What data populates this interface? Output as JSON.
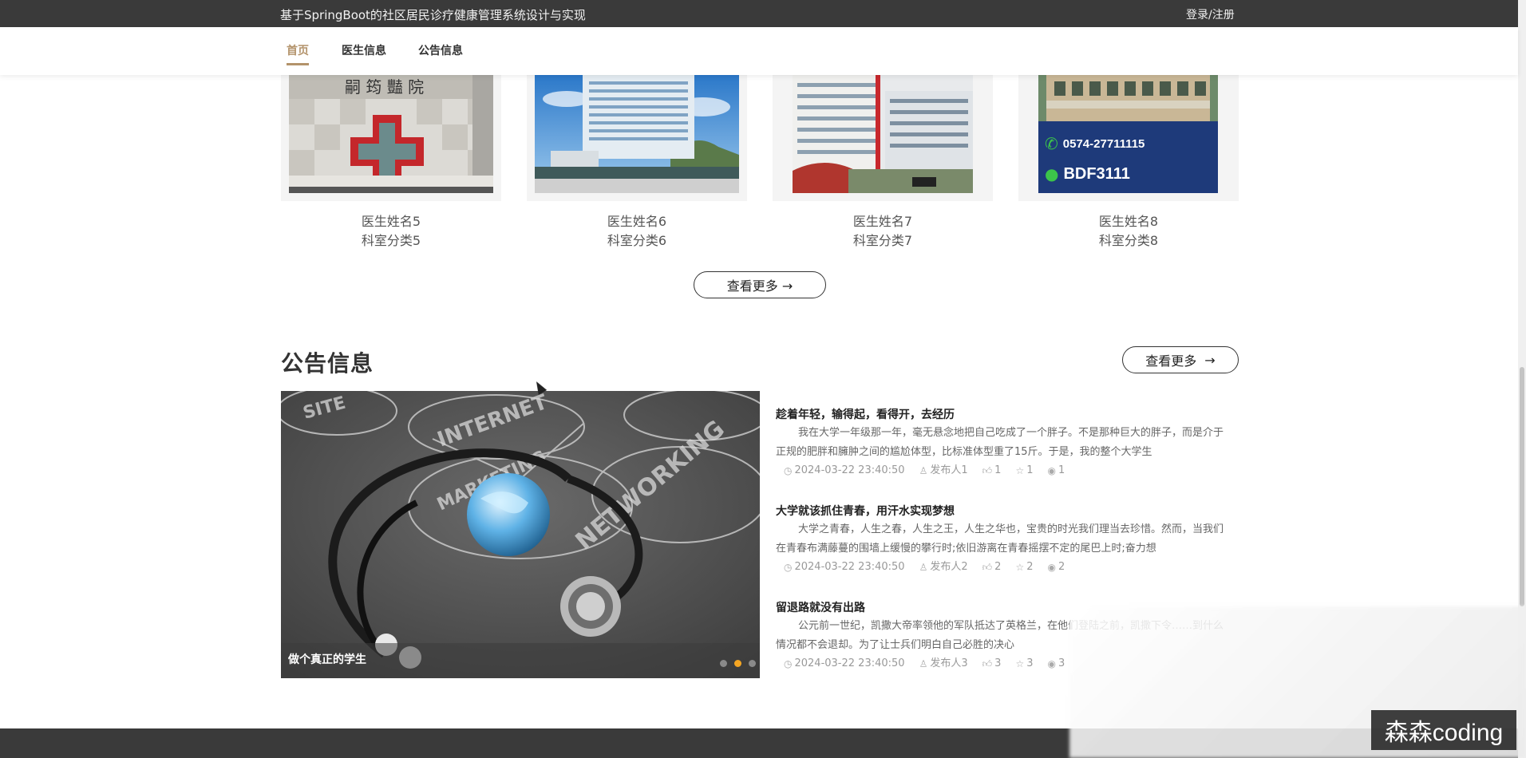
{
  "header": {
    "site_title": "基于SpringBoot的社区居民诊疗健康管理系统设计与实现",
    "login_label": "登录/注册"
  },
  "nav": {
    "items": [
      {
        "label": "首页",
        "active": true
      },
      {
        "label": "医生信息",
        "active": false
      },
      {
        "label": "公告信息",
        "active": false
      }
    ]
  },
  "doctors": [
    {
      "name": "医生姓名5",
      "department": "科室分类5"
    },
    {
      "name": "医生姓名6",
      "department": "科室分类6"
    },
    {
      "name": "医生姓名7",
      "department": "科室分类7"
    },
    {
      "name": "医生姓名8",
      "department": "科室分类8"
    }
  ],
  "doctor_ad": {
    "phone": "0574-27711115",
    "wechat": "BDF3111"
  },
  "doctor_section": {
    "more_label": "查看更多 →"
  },
  "notice_section": {
    "title": "公告信息",
    "more_label": "查看更多",
    "more_arrow": "→"
  },
  "carousel": {
    "caption": "做个真正的学生",
    "dot_count": 3,
    "active_dot": 1,
    "chalk_words": [
      "SITE",
      "INTERNET",
      "NETWORKING",
      "MARKETING"
    ]
  },
  "news": [
    {
      "title": "趁着年轻，输得起，看得开，去经历",
      "summary": "我在大学一年级那一年，毫无悬念地把自己吃成了一个胖子。不是那种巨大的胖子，而是介于正规的肥胖和臃肿之间的尴尬体型，比标准体型重了15斤。于是，我的整个大学生",
      "time": "2024-03-22 23:40:50",
      "publisher": "发布人1",
      "likes": "1",
      "favorites": "1",
      "views": "1"
    },
    {
      "title": "大学就该抓住青春，用汗水实现梦想",
      "summary": "大学之青春，人生之春，人生之王，人生之华也，宝贵的时光我们理当去珍惜。然而，当我们在青春布满藤蔓的围墙上缓慢的攀行时;依旧游离在青春摇摆不定的尾巴上时;奋力想",
      "time": "2024-03-22 23:40:50",
      "publisher": "发布人2",
      "likes": "2",
      "favorites": "2",
      "views": "2"
    },
    {
      "title": "留退路就没有出路",
      "summary": "公元前一世纪，凯撒大帝率领他的军队抵达了英格兰，在他们登陆之前，凯撒下令……到什么情况都不会退却。为了让士兵们明白自己必胜的决心",
      "time": "2024-03-22 23:40:50",
      "publisher": "发布人3",
      "likes": "3",
      "favorites": "3",
      "views": "3"
    }
  ],
  "watermark": "森森coding",
  "colors": {
    "topbar": "#3a3a3a",
    "accent": "#b3936b",
    "carousel_dot_active": "#f5a623"
  }
}
